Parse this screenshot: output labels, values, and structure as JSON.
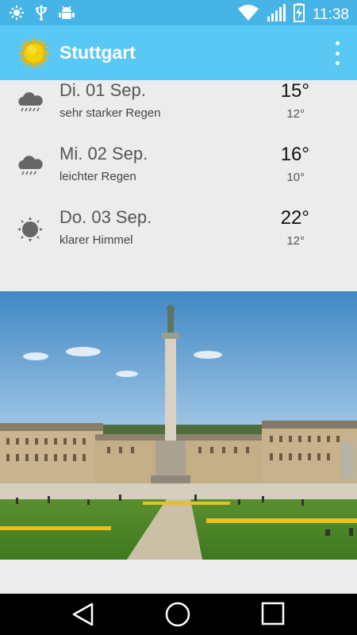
{
  "status_bar": {
    "time": "11:38",
    "left_icons": [
      "weather-sun-icon",
      "usb-icon",
      "android-debug-icon"
    ],
    "right_icons": [
      "wifi-icon",
      "signal-icon",
      "battery-charging-icon"
    ]
  },
  "app_bar": {
    "title": "Stuttgart",
    "logo_icon": "sun-icon",
    "menu_icon": "overflow-menu-icon"
  },
  "forecast": [
    {
      "date": "Di. 01 Sep.",
      "description": "sehr starker Regen",
      "high": "15°",
      "low": "12°",
      "icon": "rain-cloud-icon"
    },
    {
      "date": "Mi. 02 Sep.",
      "description": "leichter Regen",
      "high": "16°",
      "low": "10°",
      "icon": "rain-cloud-icon"
    },
    {
      "date": "Do. 03 Sep.",
      "description": "klarer Himmel",
      "high": "22°",
      "low": "12°",
      "icon": "clear-sun-icon"
    }
  ],
  "photo": {
    "subject": "city-photo"
  },
  "nav_bar": {
    "buttons": [
      "back-icon",
      "home-icon",
      "recents-icon"
    ]
  },
  "colors": {
    "status_bar": "#46b4e6",
    "app_bar": "#5ac8f5",
    "background": "#ececec",
    "sun": "#f5c800"
  }
}
